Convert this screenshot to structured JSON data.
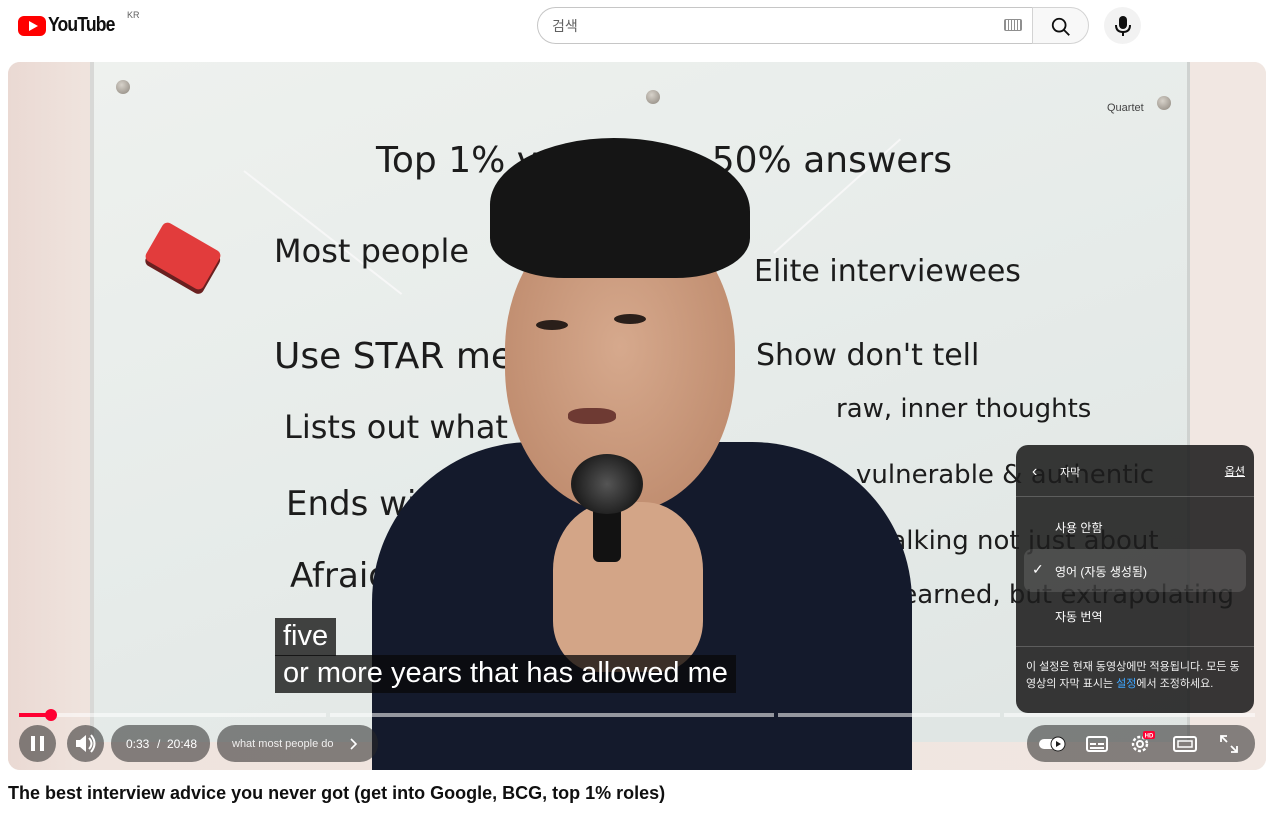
{
  "masthead": {
    "logo_text": "YouTube",
    "country_code": "KR",
    "search_placeholder": "검색"
  },
  "board": {
    "brand": "Quartet",
    "heading": "Top 1% vs Bottom 50% answers",
    "left_column_title": "Most people",
    "right_column_title": "Elite interviewees",
    "left_items": [
      "Use STAR me",
      "Lists out what th",
      "Ends with \"e",
      "Afraid to"
    ],
    "right_items": [
      "Show don't tell",
      "raw, inner thoughts",
      "vulnerable & authentic",
      "by talking not just about",
      "learned, but extrapolating"
    ]
  },
  "captions": {
    "line1": "five",
    "line2": "or more years that has allowed me"
  },
  "settings_panel": {
    "title": "자막",
    "options_link": "옵션",
    "items": [
      {
        "label": "사용 안함",
        "selected": false
      },
      {
        "label": "영어 (자동 생성됨)",
        "selected": true
      },
      {
        "label": "자동 번역",
        "selected": false
      }
    ],
    "footer_before": "이 설정은 현재 동영상에만 적용됩니다. 모든 동영상의 자막 표시는 ",
    "footer_link": "설정",
    "footer_after": "에서 조정하세요."
  },
  "player": {
    "current_time": "0:33",
    "separator": "/",
    "duration": "20:48",
    "chapter_title": "what most people do",
    "progress_fraction": 0.026,
    "settings_badge": "HD",
    "accent_color": "#ff0033"
  },
  "video": {
    "title": "The best interview advice you never got (get into Google, BCG, top 1% roles)"
  }
}
